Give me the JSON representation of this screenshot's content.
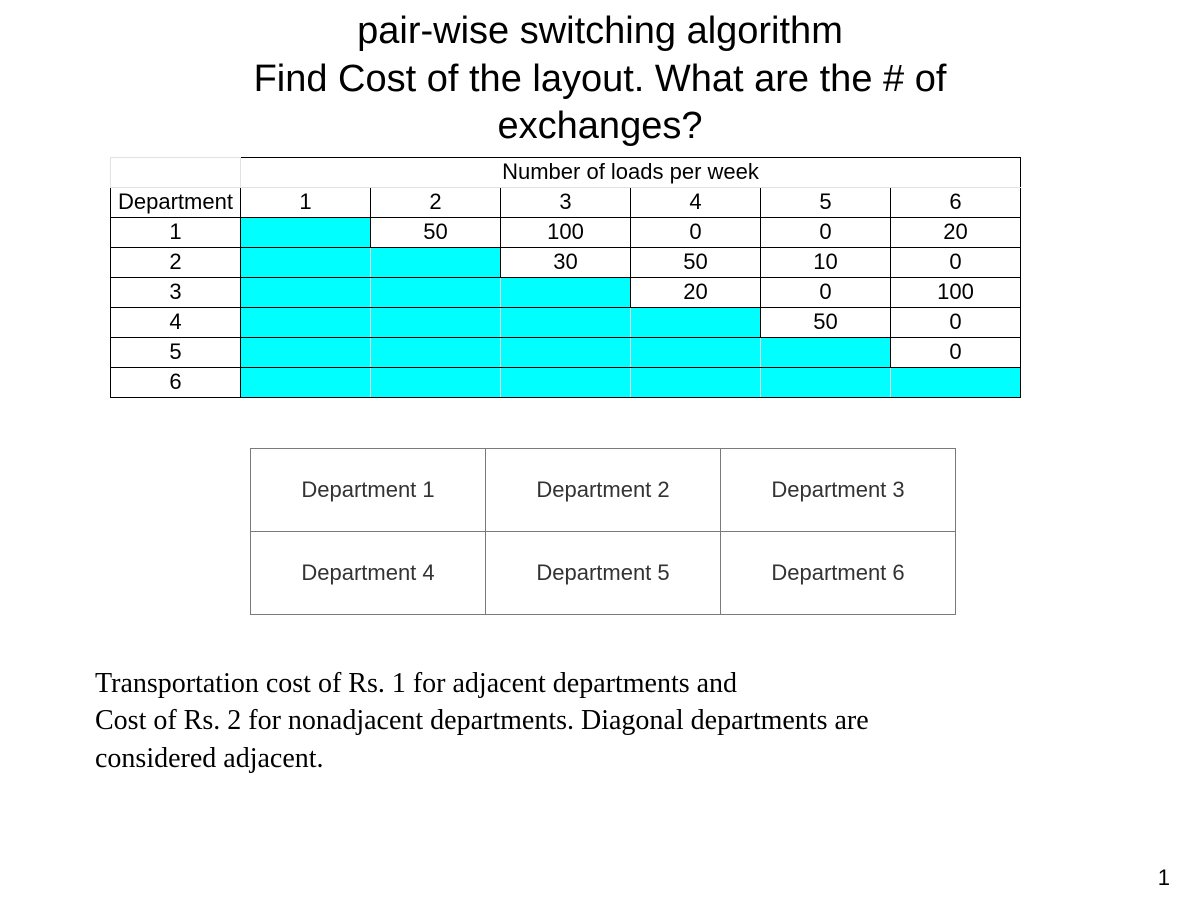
{
  "title": {
    "line1": "pair-wise switching algorithm",
    "line2": "Find Cost of the layout. What are the # of",
    "line3": "exchanges?"
  },
  "loads": {
    "header_title": "Number of loads per week",
    "row_label": "Department",
    "col_headers": {
      "c1": "1",
      "c2": "2",
      "c3": "3",
      "c4": "4",
      "c5": "5",
      "c6": "6"
    },
    "rows": {
      "r1": {
        "label": "1",
        "v2": "50",
        "v3": "100",
        "v4": "0",
        "v5": "0",
        "v6": "20"
      },
      "r2": {
        "label": "2",
        "v3": "30",
        "v4": "50",
        "v5": "10",
        "v6": "0"
      },
      "r3": {
        "label": "3",
        "v4": "20",
        "v5": "0",
        "v6": "100"
      },
      "r4": {
        "label": "4",
        "v5": "50",
        "v6": "0"
      },
      "r5": {
        "label": "5",
        "v6": "0"
      },
      "r6": {
        "label": "6"
      }
    }
  },
  "layout_grid": {
    "r1c1": "Department 1",
    "r1c2": "Department 2",
    "r1c3": "Department 3",
    "r2c1": "Department 4",
    "r2c2": "Department 5",
    "r2c3": "Department 6"
  },
  "cost_text": {
    "line1": "Transportation cost of Rs. 1 for adjacent departments and",
    "line2": "Cost of Rs. 2 for nonadjacent departments. Diagonal departments are",
    "line3": "considered adjacent."
  },
  "page_number": "1"
}
